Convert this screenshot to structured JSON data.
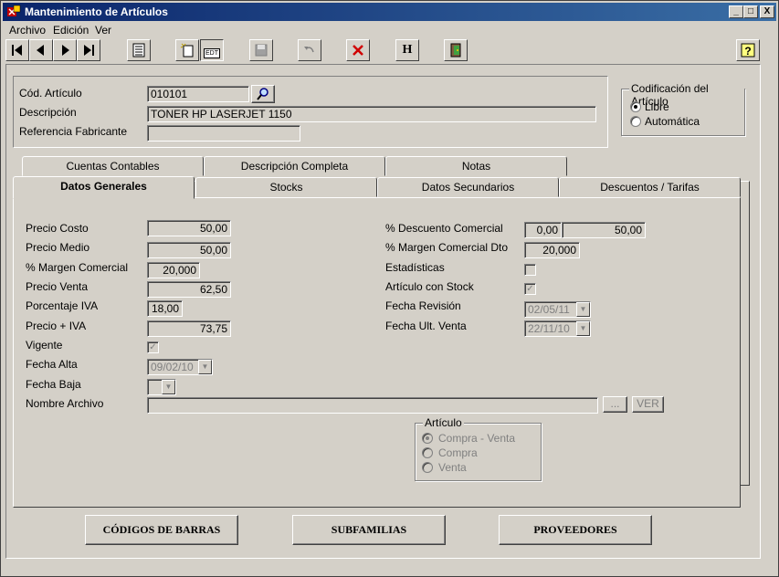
{
  "window": {
    "title": "Mantenimiento de Artículos"
  },
  "window_buttons": {
    "minimize": "_",
    "maximize": "□",
    "close": "X"
  },
  "menu": [
    "Archivo",
    "Edición",
    "Ver"
  ],
  "toolbar": {
    "help_glyph": "?",
    "h_label": "H",
    "new_label": "EDT"
  },
  "header": {
    "cod_articulo_label": "Cód. Artículo",
    "cod_articulo_value": "010101",
    "descripcion_label": "Descripción",
    "descripcion_value": "TONER HP LASERJET 1150",
    "referencia_label": "Referencia Fabricante",
    "referencia_value": ""
  },
  "codificacion": {
    "title": "Codificación del Artículo",
    "options": [
      "Libre",
      "Automática"
    ],
    "selected": "Libre"
  },
  "tabs_back": [
    "Cuentas Contables",
    "Descripción Completa",
    "Notas"
  ],
  "tabs_front": [
    "Datos Generales",
    "Stocks",
    "Datos Secundarios",
    "Descuentos / Tarifas"
  ],
  "active_tab": "Datos Generales",
  "left_fields": {
    "precio_costo_label": "Precio Costo",
    "precio_costo": "50,00",
    "precio_medio_label": "Precio Medio",
    "precio_medio": "50,00",
    "margen_comercial_label": "% Margen Comercial",
    "margen_comercial": "20,000",
    "precio_venta_label": "Precio Venta",
    "precio_venta": "62,50",
    "porcentaje_iva_label": "Porcentaje IVA",
    "porcentaje_iva": "18,00",
    "precio_iva_label": "Precio + IVA",
    "precio_iva": "73,75",
    "vigente_label": "Vigente",
    "fecha_alta_label": "Fecha Alta",
    "fecha_alta": "09/02/10",
    "fecha_baja_label": "Fecha Baja",
    "nombre_archivo_label": "Nombre Archivo",
    "ellipsis_label": "...",
    "ver_label": "VER"
  },
  "right_fields": {
    "descuento_comercial_label": "% Descuento Comercial",
    "descuento_comercial_1": "0,00",
    "descuento_comercial_2": "50,00",
    "margen_dto_label": "% Margen Comercial Dto",
    "margen_dto": "20,000",
    "estadisticas_label": "Estadísticas",
    "articulo_stock_label": "Artículo con Stock",
    "fecha_revision_label": "Fecha Revisión",
    "fecha_revision": "02/05/11",
    "fecha_ult_venta_label": "Fecha Ult. Venta",
    "fecha_ult_venta": "22/11/10"
  },
  "articulo_group": {
    "title": "Artículo",
    "options": [
      "Compra - Venta",
      "Compra",
      "Venta"
    ]
  },
  "bottom_buttons": [
    "CÓDIGOS DE BARRAS",
    "SUBFAMILIAS",
    "PROVEEDORES"
  ]
}
